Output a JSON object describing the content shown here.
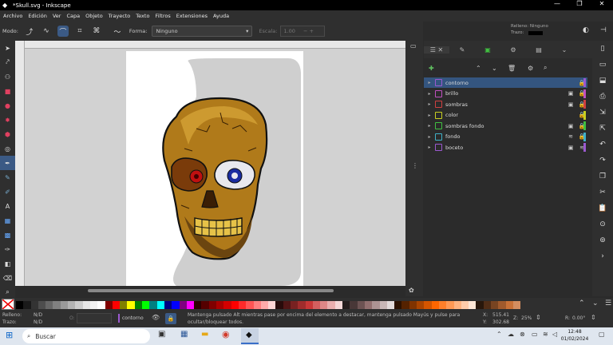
{
  "window": {
    "title": "*Skull.svg - Inkscape",
    "controls": [
      "—",
      "❐",
      "✕"
    ]
  },
  "menu": [
    "Archivo",
    "Edición",
    "Ver",
    "Capa",
    "Objeto",
    "Trayecto",
    "Texto",
    "Filtros",
    "Extensiones",
    "Ayuda"
  ],
  "toolcontrols": {
    "mode_label": "Modo:",
    "shape_label": "Forma:",
    "shape_value": "Ninguno",
    "scale_label": "Escala:",
    "scale_value": "1.00"
  },
  "fill_stroke": {
    "fill": "Relleno: Ninguno",
    "stroke": "Trazo:"
  },
  "layers": [
    {
      "name": "contorno",
      "color": "#9b59d0",
      "selected": true,
      "icons": [
        "",
        "🔒"
      ]
    },
    {
      "name": "brillo",
      "color": "#c050c0",
      "selected": false,
      "icons": [
        "▣",
        "🔒"
      ]
    },
    {
      "name": "sombras",
      "color": "#d04040",
      "selected": false,
      "icons": [
        "▣",
        "🔒"
      ]
    },
    {
      "name": "color",
      "color": "#c8d020",
      "selected": false,
      "icons": [
        "",
        "🔒"
      ]
    },
    {
      "name": "sombras fondo",
      "color": "#40c040",
      "selected": false,
      "icons": [
        "▣",
        "🔒"
      ]
    },
    {
      "name": "fondo",
      "color": "#3fb0c8",
      "selected": false,
      "icons": [
        "≋",
        "🔒"
      ]
    },
    {
      "name": "boceto",
      "color": "#9b59d0",
      "selected": false,
      "icons": [
        "▣",
        "≋"
      ]
    }
  ],
  "status": {
    "fill_label": "Relleno:",
    "fill_value": "N/D",
    "stroke_label": "Trazo:",
    "stroke_value": "N/D",
    "opacity_label": "O:",
    "layer": "contorno",
    "message": "Mantenga pulsado Alt mientras pase por encima del elemento a destacar, mantenga pulsado Mayús y pulse para ocultar/bloquear todos.",
    "x_label": "X:",
    "x_value": "515.41",
    "y_label": "Y:",
    "y_value": "302.68",
    "zoom_label": "Z:",
    "zoom_value": "25%",
    "rot_label": "R:",
    "rot_value": "0.00°"
  },
  "taskbar": {
    "search": "Buscar",
    "time": "12:48",
    "date": "01/02/2024"
  },
  "palette": [
    "#000000",
    "#1a1a1a",
    "#333333",
    "#4d4d4d",
    "#666666",
    "#808080",
    "#999999",
    "#b3b3b3",
    "#cccccc",
    "#e6e6e6",
    "#f2f2f2",
    "#ffffff",
    "#800000",
    "#ff0000",
    "#808000",
    "#ffff00",
    "#008000",
    "#00ff00",
    "#008080",
    "#00ffff",
    "#000080",
    "#0000ff",
    "#800080",
    "#ff00ff",
    "#2b0000",
    "#550000",
    "#800000",
    "#aa0000",
    "#d40000",
    "#ff0000",
    "#ff2a2a",
    "#ff5555",
    "#ff8080",
    "#ffaaaa",
    "#ffd5d5",
    "#280b0b",
    "#501616",
    "#782121",
    "#a02c2c",
    "#c83737",
    "#d35f5f",
    "#de8787",
    "#e9afaf",
    "#f4d7d7",
    "#241c1c",
    "#483737",
    "#6c5353",
    "#916f6f",
    "#ac9393",
    "#c8b7b7",
    "#e3dbdb",
    "#2b1100",
    "#552200",
    "#803300",
    "#aa4400",
    "#d45500",
    "#ff6600",
    "#ff7f2a",
    "#ff9955",
    "#ffb380",
    "#ffccaa",
    "#ffe6d5",
    "#28170b",
    "#502d16",
    "#784421",
    "#a05a2c",
    "#c87137",
    "#d38d5f"
  ]
}
